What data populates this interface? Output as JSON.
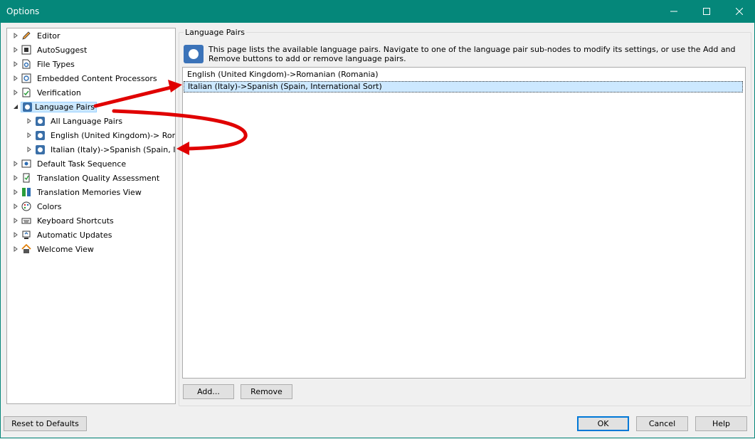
{
  "window": {
    "title": "Options",
    "controls": {
      "minimize": "minimize",
      "maximize": "maximize",
      "close": "close"
    }
  },
  "tree": {
    "items": [
      {
        "label": "Editor",
        "icon": "pencil-icon"
      },
      {
        "label": "AutoSuggest",
        "icon": "autosuggest-icon"
      },
      {
        "label": "File Types",
        "icon": "file-gear-icon"
      },
      {
        "label": "Embedded Content Processors",
        "icon": "embedded-icon"
      },
      {
        "label": "Verification",
        "icon": "verification-icon"
      },
      {
        "label": "Language Pairs",
        "icon": "language-pair-icon",
        "selected": true
      },
      {
        "label": "All Language Pairs",
        "icon": "language-pair-icon"
      },
      {
        "label": "English (United Kingdom)-> Roma",
        "icon": "language-pair-icon"
      },
      {
        "label": "Italian (Italy)->Spanish (Spain, Inte",
        "icon": "language-pair-icon"
      },
      {
        "label": "Default Task Sequence",
        "icon": "task-sequence-icon"
      },
      {
        "label": "Translation Quality Assessment",
        "icon": "tqa-icon"
      },
      {
        "label": "Translation Memories View",
        "icon": "tm-view-icon"
      },
      {
        "label": "Colors",
        "icon": "palette-icon"
      },
      {
        "label": "Keyboard Shortcuts",
        "icon": "keyboard-icon"
      },
      {
        "label": "Automatic Updates",
        "icon": "updates-icon"
      },
      {
        "label": "Welcome View",
        "icon": "home-icon"
      }
    ]
  },
  "panel": {
    "title": "Language Pairs",
    "info": "This page lists the available language pairs. Navigate to one of the language pair sub-nodes to modify its settings, or use the Add and Remove buttons to add or remove language pairs.",
    "list": [
      {
        "label": "English (United Kingdom)->Romanian (Romania)"
      },
      {
        "label": "Italian (Italy)->Spanish (Spain, International Sort)",
        "selected": true
      }
    ],
    "add_label": "Add...",
    "remove_label": "Remove"
  },
  "footer": {
    "reset_label": "Reset to Defaults",
    "ok_label": "OK",
    "cancel_label": "Cancel",
    "help_label": "Help"
  },
  "colors": {
    "titlebar": "#05877a",
    "selection": "#cce8ff",
    "annotation_arrow": "#e00000",
    "default_button_border": "#0078d7"
  }
}
